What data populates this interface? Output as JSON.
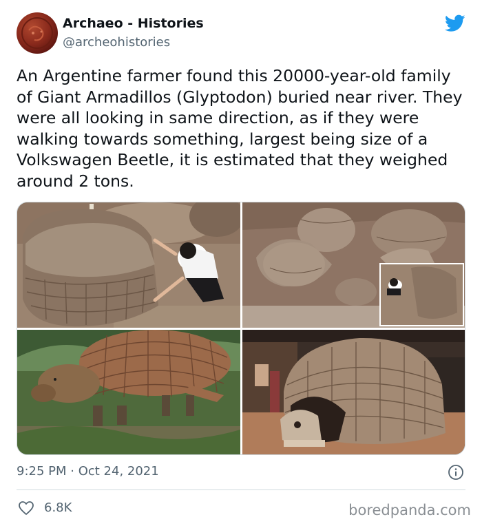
{
  "author": {
    "display_name": "Archaeo - Histories",
    "handle": "@archeohistories",
    "avatar_icon": "coin-avatar"
  },
  "tweet": {
    "text": "An Argentine farmer found this 20000-year-old family of Giant Armadillos (Glyptodon) buried near river. They were all looking in same direction, as if they were walking towards something, largest being size of a Volkswagen Beetle, it is estimated that they weighed around 2 tons.",
    "timestamp": "9:25 PM · Oct 24, 2021",
    "likes": "6.8K"
  },
  "media": [
    {
      "name": "photo-excavation-woman-touching-shell"
    },
    {
      "name": "photo-excavation-site-multiple-shells"
    },
    {
      "name": "illustration-glyptodon-reconstruction"
    },
    {
      "name": "photo-museum-glyptodon-skeleton"
    }
  ],
  "icons": {
    "platform": "twitter-bird-icon",
    "info": "info-icon",
    "like": "heart-icon"
  },
  "colors": {
    "twitter_blue": "#1d9bf0",
    "secondary_text": "#536471",
    "divider": "#cfd9de"
  },
  "watermark": "boredpanda.com"
}
